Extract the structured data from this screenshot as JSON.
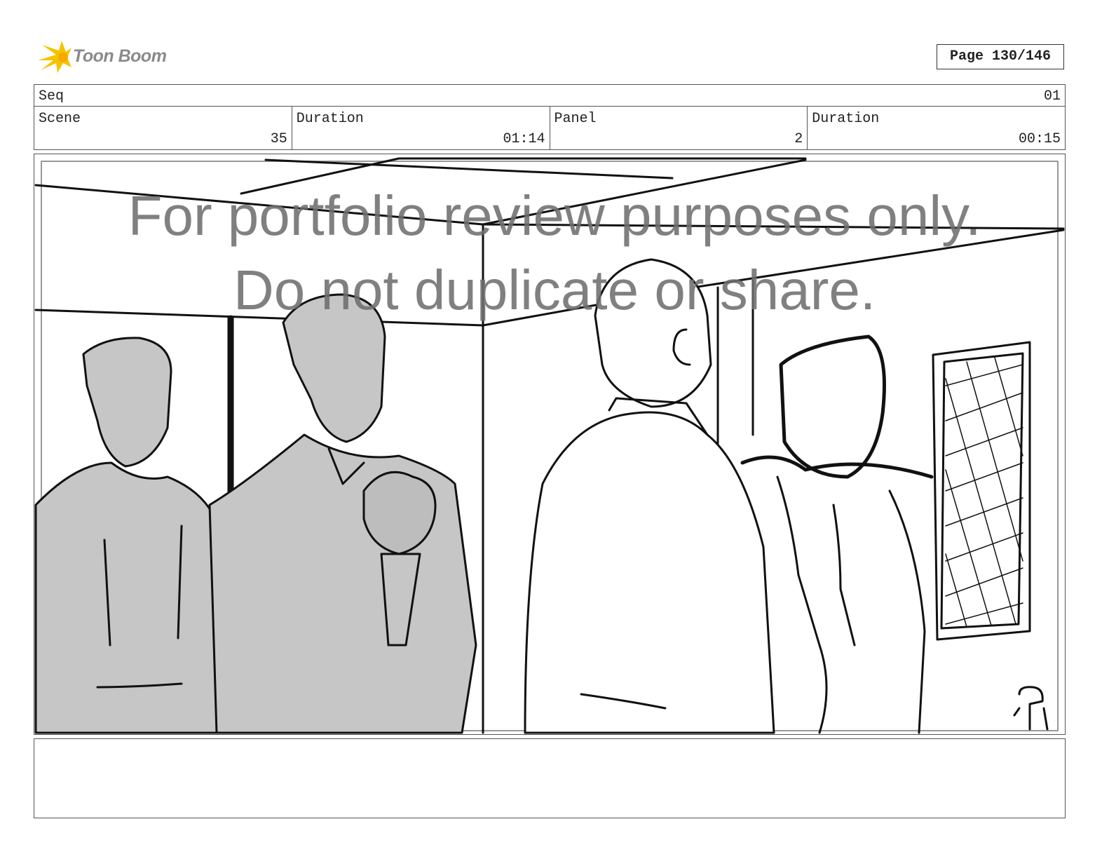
{
  "header": {
    "logo_text": "Toon Boom",
    "page_label": "Page 130/146"
  },
  "seq": {
    "label": "Seq",
    "value": "01"
  },
  "meta": [
    {
      "label": "Scene",
      "value": "35"
    },
    {
      "label": "Duration",
      "value": "01:14"
    },
    {
      "label": "Panel",
      "value": "2"
    },
    {
      "label": "Duration",
      "value": "00:15"
    }
  ],
  "watermark": {
    "line1": "For portfolio review purposes only.",
    "line2": "Do not duplicate or share."
  },
  "notes": {
    "text": ""
  },
  "colors": {
    "logo_accent": "#f5c400",
    "figure_fill": "#c6c6c6",
    "line": "#111111"
  }
}
